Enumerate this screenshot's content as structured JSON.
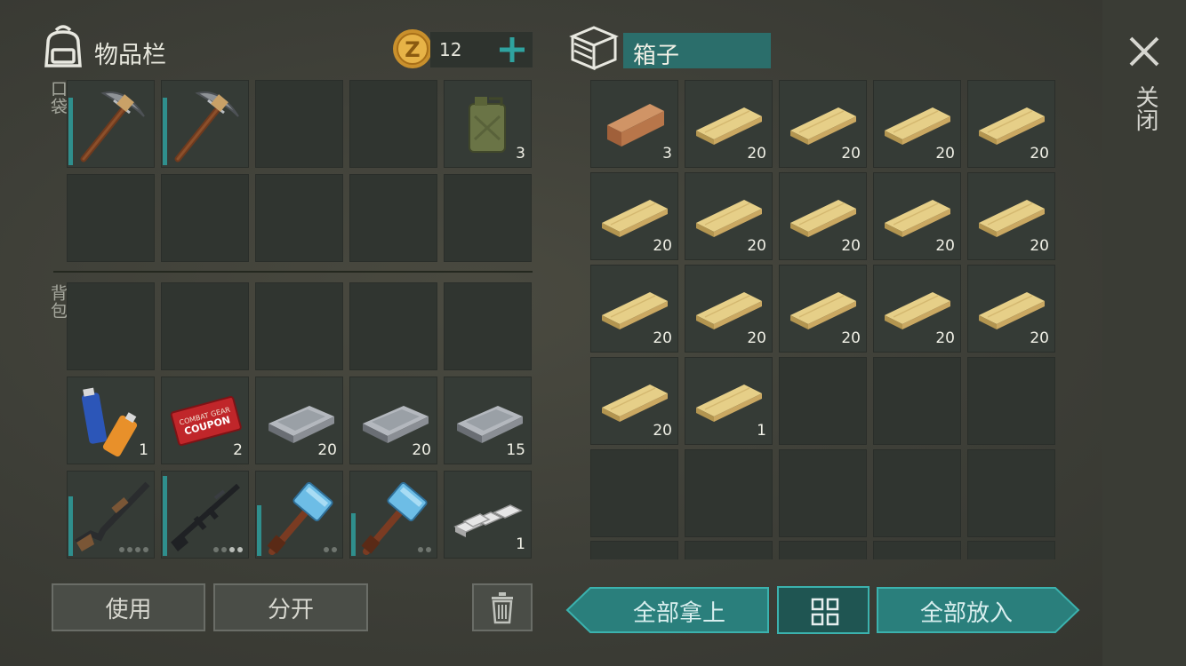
{
  "inventory": {
    "title": "物品栏",
    "coins": "12",
    "pocket_label": "口袋",
    "backpack_label": "背包",
    "pocket_slots": [
      {
        "icon": "pickaxe-icon",
        "count": "",
        "durability": 0.8
      },
      {
        "icon": "pickaxe-icon",
        "count": "",
        "durability": 0.8
      },
      {
        "icon": "",
        "count": ""
      },
      {
        "icon": "",
        "count": ""
      },
      {
        "icon": "jerrycan-icon",
        "count": "3"
      },
      {
        "icon": "",
        "count": ""
      },
      {
        "icon": "",
        "count": ""
      },
      {
        "icon": "",
        "count": ""
      },
      {
        "icon": "",
        "count": ""
      },
      {
        "icon": "",
        "count": ""
      }
    ],
    "backpack_slots": [
      {
        "icon": "",
        "count": ""
      },
      {
        "icon": "",
        "count": ""
      },
      {
        "icon": "",
        "count": ""
      },
      {
        "icon": "",
        "count": ""
      },
      {
        "icon": "",
        "count": ""
      },
      {
        "icon": "batteries-icon",
        "count": "1"
      },
      {
        "icon": "coupon-icon",
        "count": "2"
      },
      {
        "icon": "iron-bar-icon",
        "count": "20"
      },
      {
        "icon": "iron-bar-icon",
        "count": "20"
      },
      {
        "icon": "iron-bar-icon",
        "count": "15"
      },
      {
        "icon": "shotgun-icon",
        "count": "",
        "durability": 0.7,
        "ammo": [
          false,
          false,
          false,
          false
        ]
      },
      {
        "icon": "rifle-icon",
        "count": "",
        "durability": 0.95,
        "ammo": [
          false,
          false,
          true,
          true
        ]
      },
      {
        "icon": "sledgehammer-icon",
        "count": "",
        "durability": 0.6,
        "ammo": [
          false,
          false
        ]
      },
      {
        "icon": "sledgehammer-icon",
        "count": "",
        "durability": 0.5,
        "ammo": [
          false,
          false
        ]
      },
      {
        "icon": "silver-bars-icon",
        "count": "1"
      }
    ],
    "coupon_text_1": "COMBAT GEAR",
    "coupon_text_2": "COUPON",
    "use_label": "使用",
    "split_label": "分开"
  },
  "box": {
    "title": "箱子",
    "slots": [
      {
        "icon": "wood-log-icon",
        "count": "3"
      },
      {
        "icon": "plank-icon",
        "count": "20"
      },
      {
        "icon": "plank-icon",
        "count": "20"
      },
      {
        "icon": "plank-icon",
        "count": "20"
      },
      {
        "icon": "plank-icon",
        "count": "20"
      },
      {
        "icon": "plank-icon",
        "count": "20"
      },
      {
        "icon": "plank-icon",
        "count": "20"
      },
      {
        "icon": "plank-icon",
        "count": "20"
      },
      {
        "icon": "plank-icon",
        "count": "20"
      },
      {
        "icon": "plank-icon",
        "count": "20"
      },
      {
        "icon": "plank-icon",
        "count": "20"
      },
      {
        "icon": "plank-icon",
        "count": "20"
      },
      {
        "icon": "plank-icon",
        "count": "20"
      },
      {
        "icon": "plank-icon",
        "count": "20"
      },
      {
        "icon": "plank-icon",
        "count": "20"
      },
      {
        "icon": "plank-icon",
        "count": "20"
      },
      {
        "icon": "plank-icon",
        "count": "1"
      },
      {
        "icon": "",
        "count": ""
      },
      {
        "icon": "",
        "count": ""
      },
      {
        "icon": "",
        "count": ""
      },
      {
        "icon": "",
        "count": ""
      },
      {
        "icon": "",
        "count": ""
      },
      {
        "icon": "",
        "count": ""
      },
      {
        "icon": "",
        "count": ""
      },
      {
        "icon": "",
        "count": ""
      }
    ],
    "take_all_label": "全部拿上",
    "put_all_label": "全部放入"
  },
  "close_label": "关闭",
  "colors": {
    "teal": "#2f8f8d",
    "teal_dark": "#1f5f5d",
    "slot": "#303530"
  }
}
